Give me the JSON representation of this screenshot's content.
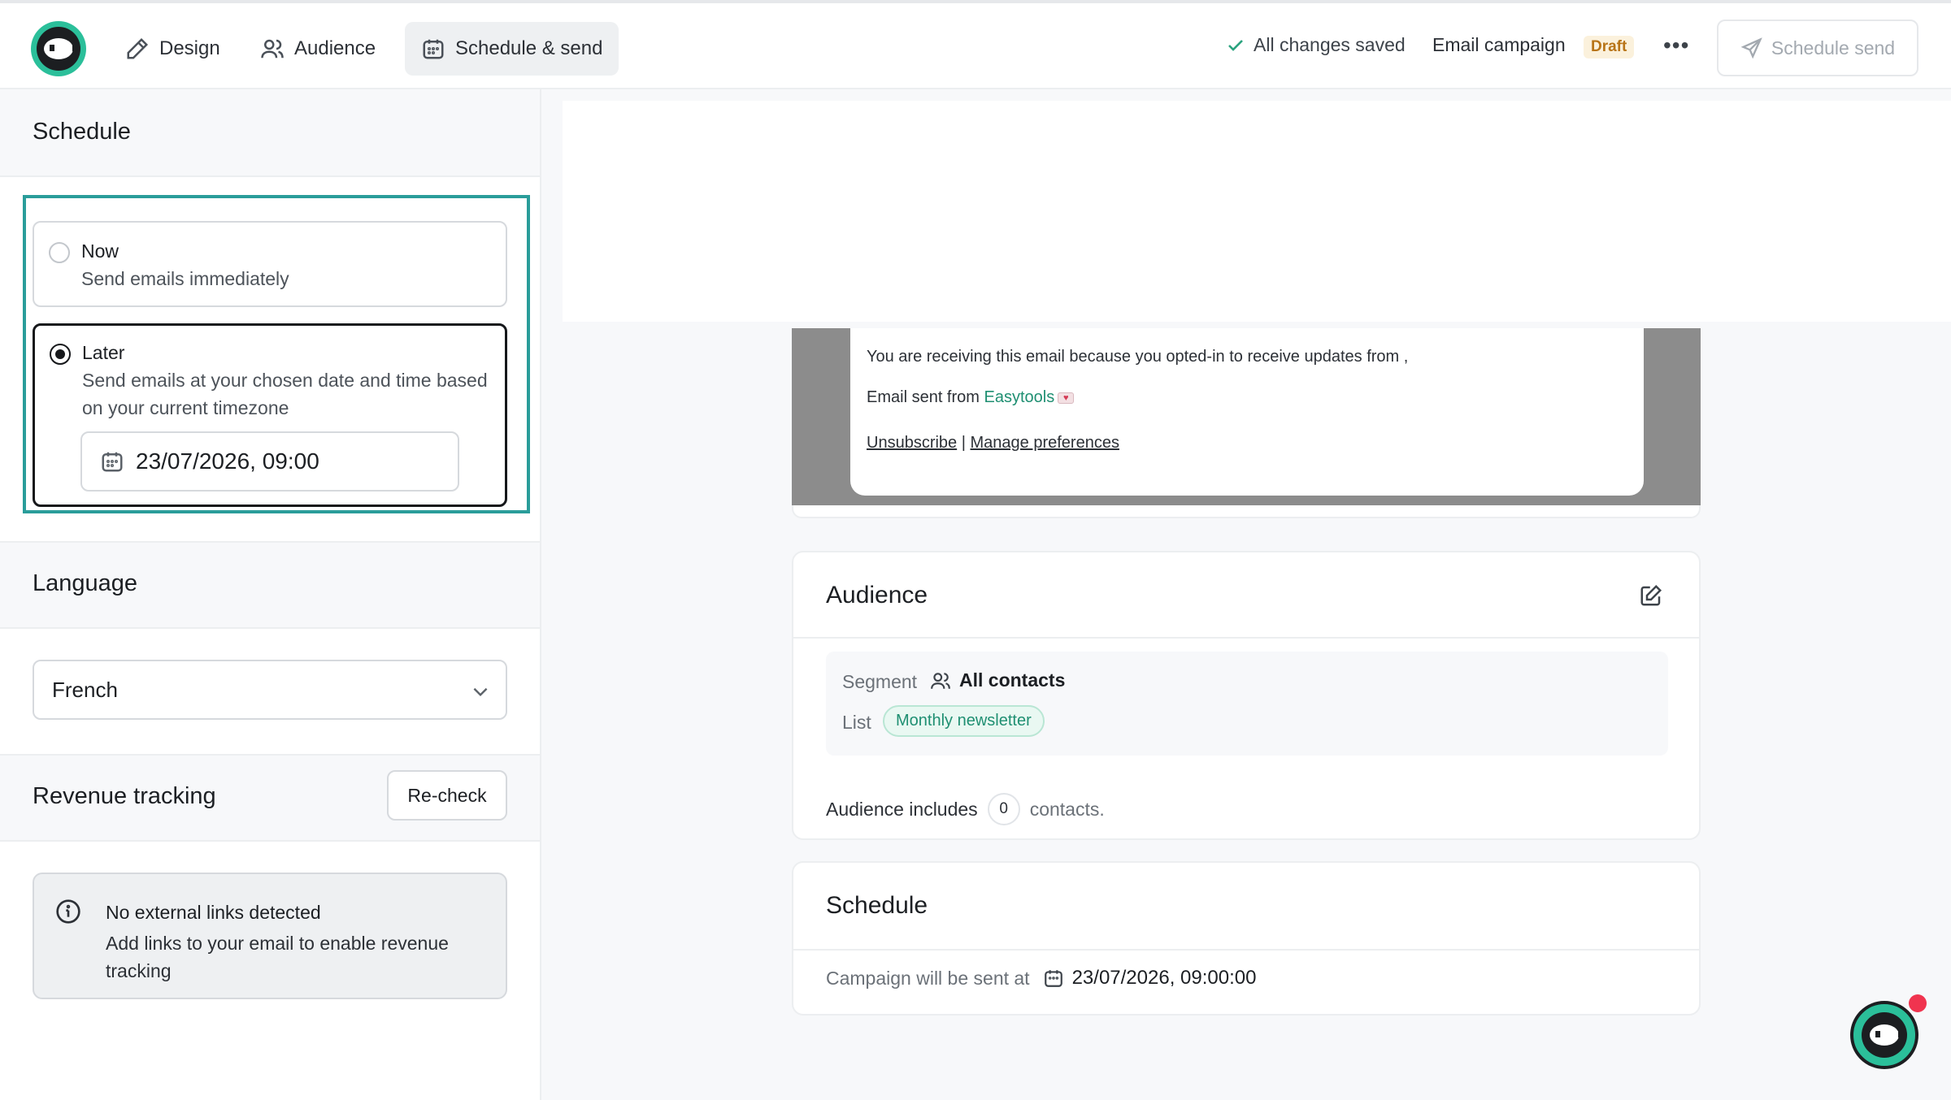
{
  "header": {
    "tabs": [
      {
        "label": "Design",
        "icon": "pen-icon"
      },
      {
        "label": "Audience",
        "icon": "users-icon"
      },
      {
        "label": "Schedule & send",
        "icon": "calendar-icon",
        "active": true
      }
    ],
    "saved_status": "All changes saved",
    "campaign_type": "Email campaign",
    "status_badge": "Draft",
    "more_label": "•••",
    "primary_action": "Schedule send"
  },
  "sidebar": {
    "schedule": {
      "title": "Schedule",
      "options": [
        {
          "title": "Now",
          "description": "Send emails immediately",
          "selected": false
        },
        {
          "title": "Later",
          "description": "Send emails at your chosen date and time based on your current timezone",
          "selected": true
        }
      ],
      "datetime_value": "23/07/2026, 09:00"
    },
    "language": {
      "title": "Language",
      "selected": "French"
    },
    "revenue": {
      "title": "Revenue tracking",
      "recheck_label": "Re-check",
      "info_title": "No external links detected",
      "info_description": "Add links to your email to enable revenue tracking"
    }
  },
  "preview": {
    "footer_line1": "You are receiving this email because you opted-in to receive updates from ,",
    "sent_from_prefix": "Email sent from ",
    "sent_from_link": "Easytools",
    "unsubscribe": "Unsubscribe",
    "separator": "|",
    "manage_preferences": "Manage preferences"
  },
  "audience_card": {
    "title": "Audience",
    "segment_label": "Segment",
    "segment_value": "All contacts",
    "list_label": "List",
    "list_value": "Monthly newsletter",
    "includes_prefix": "Audience includes",
    "count": "0",
    "includes_suffix": "contacts."
  },
  "schedule_card": {
    "title": "Schedule",
    "sent_at_label": "Campaign will be sent at",
    "sent_at_value": "23/07/2026, 09:00:00"
  },
  "colors": {
    "accent": "#2bbf9a",
    "highlight": "#2a9d9a",
    "link": "#1f8f72",
    "draft_text": "#b87417",
    "notification": "#f0344f"
  }
}
